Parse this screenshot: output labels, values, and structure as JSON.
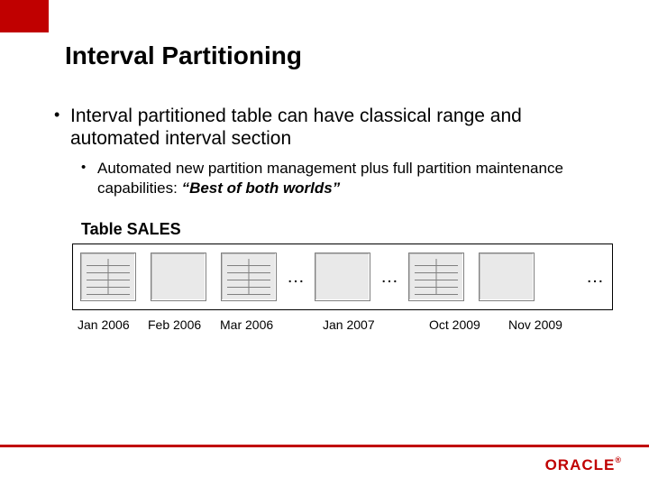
{
  "title": "Interval Partitioning",
  "bullets": {
    "b1": "Interval partitioned table can have classical range and automated interval section",
    "b2_prefix": "Automated new partition management plus full partition maintenance capabilities: ",
    "b2_emph": "“Best of both worlds”"
  },
  "table_label": "Table SALES",
  "ellipsis": "…",
  "partitions": [
    {
      "label": "Jan 2006",
      "filled": true
    },
    {
      "label": "Feb 2006",
      "filled": false
    },
    {
      "label": "Mar 2006",
      "filled": true
    },
    {
      "label": "Jan 2007",
      "filled": false
    },
    {
      "label": "Oct 2009",
      "filled": true
    },
    {
      "label": "Nov 2009",
      "filled": false
    }
  ],
  "logo": {
    "text": "ORACLE",
    "reg": "®"
  },
  "colors": {
    "accent": "#c00000"
  }
}
